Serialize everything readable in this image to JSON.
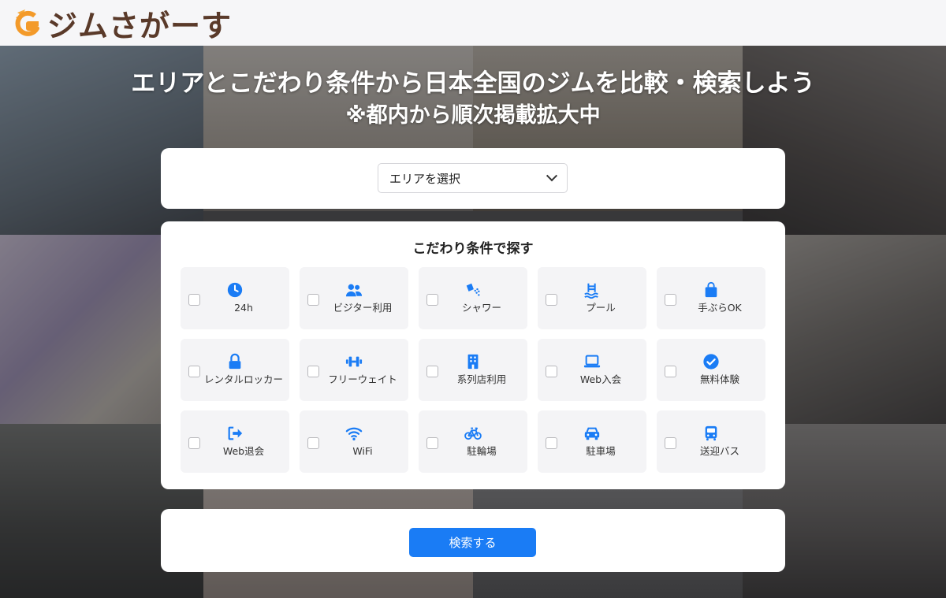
{
  "header": {
    "logo_text": "ジムさがーす",
    "logo_icon": "flame-g-logo"
  },
  "hero": {
    "headline": "エリアとこだわり条件から日本全国のジムを比較・検索しよう",
    "subheadline": "※都内から順次掲載拡大中"
  },
  "area": {
    "select_label": "エリアを選択",
    "icon": "chevron-down-icon"
  },
  "conditions": {
    "title": "こだわり条件で探す",
    "items": [
      {
        "label": "24h",
        "icon": "clock-icon"
      },
      {
        "label": "ビジター利用",
        "icon": "users-icon"
      },
      {
        "label": "シャワー",
        "icon": "shower-icon"
      },
      {
        "label": "プール",
        "icon": "pool-icon"
      },
      {
        "label": "手ぶらOK",
        "icon": "bag-icon"
      },
      {
        "label": "レンタルロッカー",
        "icon": "lock-icon"
      },
      {
        "label": "フリーウェイト",
        "icon": "dumbbell-icon"
      },
      {
        "label": "系列店利用",
        "icon": "building-icon"
      },
      {
        "label": "Web入会",
        "icon": "laptop-icon"
      },
      {
        "label": "無料体験",
        "icon": "check-circle-icon"
      },
      {
        "label": "Web退会",
        "icon": "sign-out-icon"
      },
      {
        "label": "WiFi",
        "icon": "wifi-icon"
      },
      {
        "label": "駐輪場",
        "icon": "bicycle-icon"
      },
      {
        "label": "駐車場",
        "icon": "car-icon"
      },
      {
        "label": "送迎バス",
        "icon": "bus-icon"
      }
    ]
  },
  "search": {
    "button_label": "検索する"
  },
  "colors": {
    "accent": "#1a7cf5",
    "brand_text": "#5a3a2a",
    "brand_orange": "#f39a2a"
  }
}
